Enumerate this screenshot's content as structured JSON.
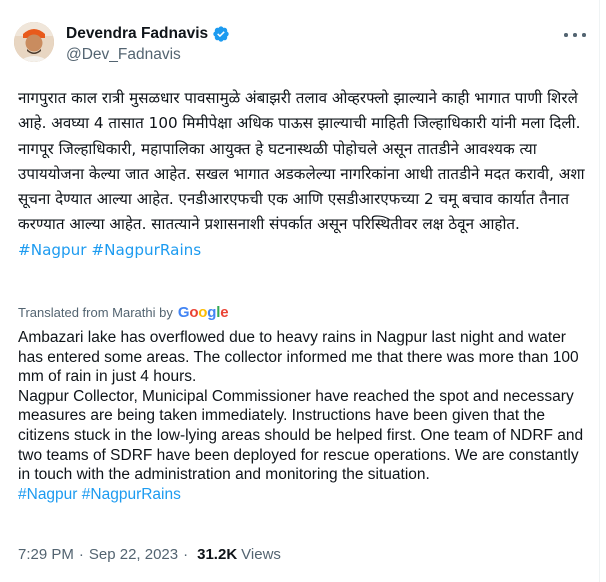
{
  "author": {
    "display_name": "Devendra Fadnavis",
    "handle": "@Dev_Fadnavis",
    "verified_color": "#1d9bf0"
  },
  "tweet": {
    "original_lines": [
      "नागपुरात काल रात्री मुसळधार पावसामुळे अंबाझरी तलाव ओव्हरफ्लो झाल्याने काही भागात पाणी शिरले आहे. अवघ्या 4 तासात 100 मिमीपेक्षा अधिक पाऊस झाल्याची माहिती जिल्हाधिकारी यांनी मला दिली.",
      "नागपूर जिल्हाधिकारी, महापालिका आयुक्त हे घटनास्थळी पोहोचले असून तातडीने आवश्यक त्या उपाययोजना केल्या जात आहेत. सखल भागात अडकलेल्या नागरिकांना आधी तातडीने मदत करावी, अशा सूचना देण्यात आल्या आहेत. एनडीआरएफची एक आणि एसडीआरएफच्या 2 चमू बचाव कार्यात तैनात करण्यात आल्या आहेत. सातत्याने प्रशासनाशी संपर्कात असून परिस्थितीवर लक्ष ठेवून आहोत."
    ],
    "hashtags": [
      "#Nagpur",
      "#NagpurRains"
    ],
    "translated_label": "Translated from Marathi by",
    "translator": "Google",
    "translation_lines": [
      "Ambazari lake has overflowed due to heavy rains in Nagpur last night and water has entered some areas. The collector informed me that there was more than 100 mm of rain in just 4 hours.",
      "Nagpur Collector, Municipal Commissioner have reached the spot and necessary measures are being taken immediately. Instructions have been given that the citizens stuck in the low-lying areas should be helped first. One team of NDRF and two teams of SDRF have been deployed for rescue operations. We are constantly in touch with the administration and monitoring the situation."
    ],
    "translation_hashtags": [
      "#Nagpur",
      "#NagpurRains"
    ],
    "time": "7:29 PM",
    "date": "Sep 22, 2023",
    "views_count": "31.2K",
    "views_label": "Views"
  },
  "colors": {
    "link": "#1d9bf0",
    "text": "#0f1419",
    "secondary": "#536471"
  },
  "icons": {
    "verified": "verified-badge-icon",
    "more": "more-options-icon"
  }
}
